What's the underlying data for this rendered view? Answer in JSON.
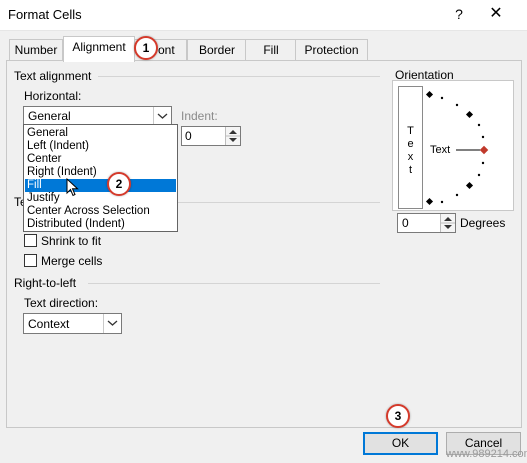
{
  "window": {
    "title": "Format Cells",
    "help_glyph": "?",
    "close_glyph": "✕"
  },
  "tabs": [
    "Number",
    "Alignment",
    "Font",
    "Border",
    "Fill",
    "Protection"
  ],
  "tab_font_visible": "ont",
  "text_alignment": {
    "section_label": "Text alignment",
    "horizontal_label": "Horizontal:",
    "horizontal_value": "General",
    "indent_label": "Indent:",
    "indent_value": "0",
    "options": [
      "General",
      "Left (Indent)",
      "Center",
      "Right (Indent)",
      "Fill",
      "Justify",
      "Center Across Selection",
      "Distributed (Indent)"
    ],
    "highlighted_option": "Fill"
  },
  "text_control": {
    "section_label_partial": "Te",
    "shrink_label": "Shrink to fit",
    "merge_label": "Merge cells"
  },
  "right_to_left": {
    "section_label": "Right-to-left",
    "direction_label": "Text direction:",
    "direction_value": "Context"
  },
  "orientation": {
    "section_label": "Orientation",
    "vertical_text": "Text",
    "dial_text": "Text",
    "degrees_value": "0",
    "degrees_label": "Degrees"
  },
  "buttons": {
    "ok": "OK",
    "cancel": "Cancel"
  },
  "badges": [
    "1",
    "2",
    "3"
  ],
  "watermark": "www.989214.com",
  "colors": {
    "accent": "#0078d7",
    "badge_ring": "#d53a2b",
    "dial_marker": "#c0392b"
  }
}
